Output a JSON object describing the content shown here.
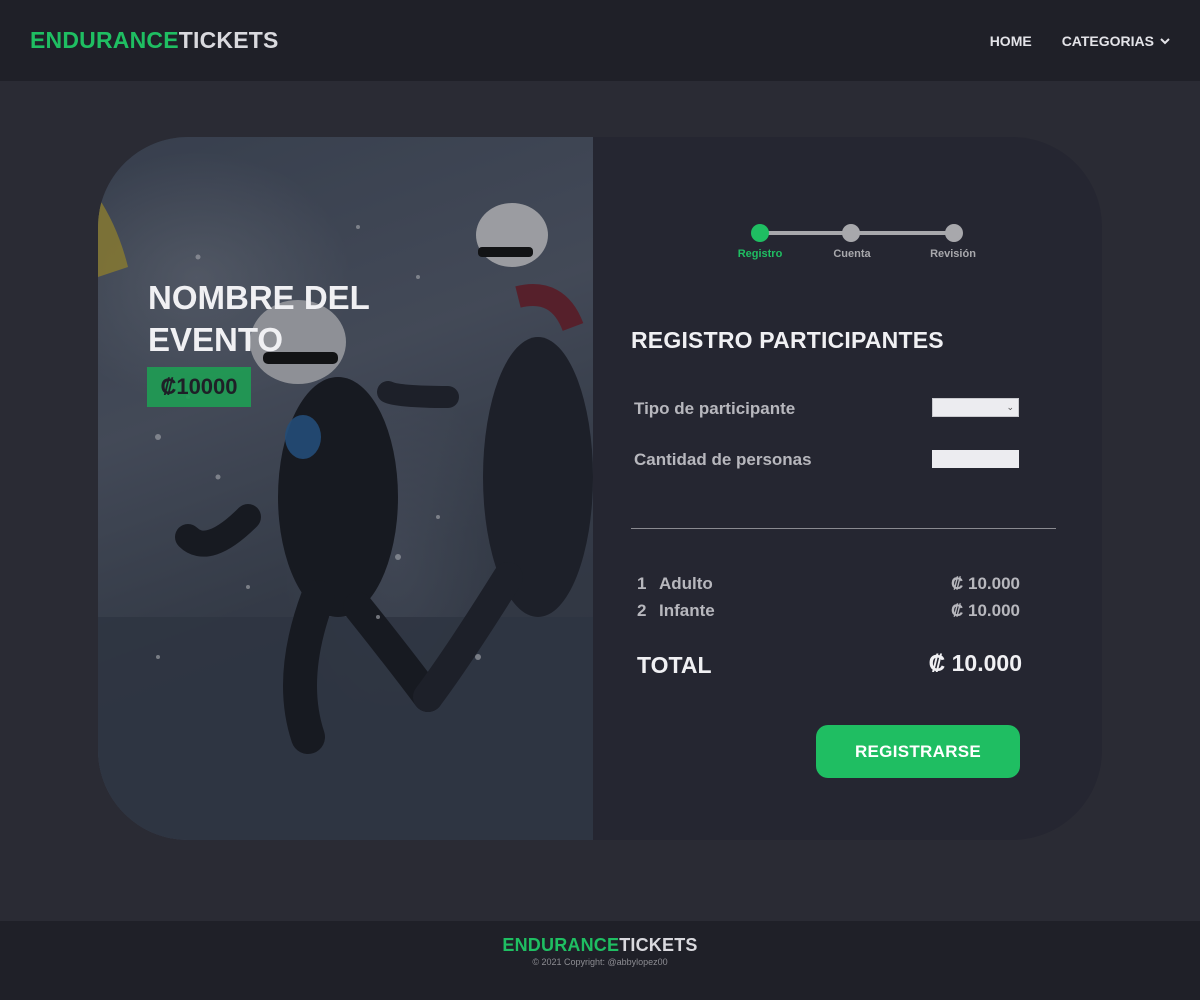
{
  "header": {
    "logo_part1": "ENDURANCE",
    "logo_part2": "TICKETS",
    "nav": [
      {
        "label": "HOME"
      },
      {
        "label": "CATEGORIAS"
      }
    ]
  },
  "event": {
    "name": "NOMBRE DEL EVENTO",
    "price": "₡10000"
  },
  "stepper": {
    "steps": [
      {
        "label": "Registro",
        "active": true
      },
      {
        "label": "Cuenta",
        "active": false
      },
      {
        "label": "Revisión",
        "active": false
      }
    ]
  },
  "form": {
    "title": "REGISTRO PARTICIPANTES",
    "participant_type_label": "Tipo de participante",
    "participant_type_value": "",
    "quantity_label": "Cantidad de personas",
    "quantity_value": ""
  },
  "summary": {
    "items": [
      {
        "num": "1",
        "name": "Adulto",
        "amount": "₡ 10.000"
      },
      {
        "num": "2",
        "name": "Infante",
        "amount": "₡ 10.000"
      }
    ],
    "total_label": "TOTAL",
    "total_amount": "₡ 10.000"
  },
  "cta": {
    "label": "REGISTRARSE"
  },
  "footer": {
    "logo_part1": "ENDURANCE",
    "logo_part2": "TICKETS",
    "copyright": "© 2021 Copyright: @abbylopez00"
  },
  "colors": {
    "accent": "#1fbe62",
    "background": "#2a2b34",
    "header": "#1f2028",
    "card": "#252631"
  }
}
